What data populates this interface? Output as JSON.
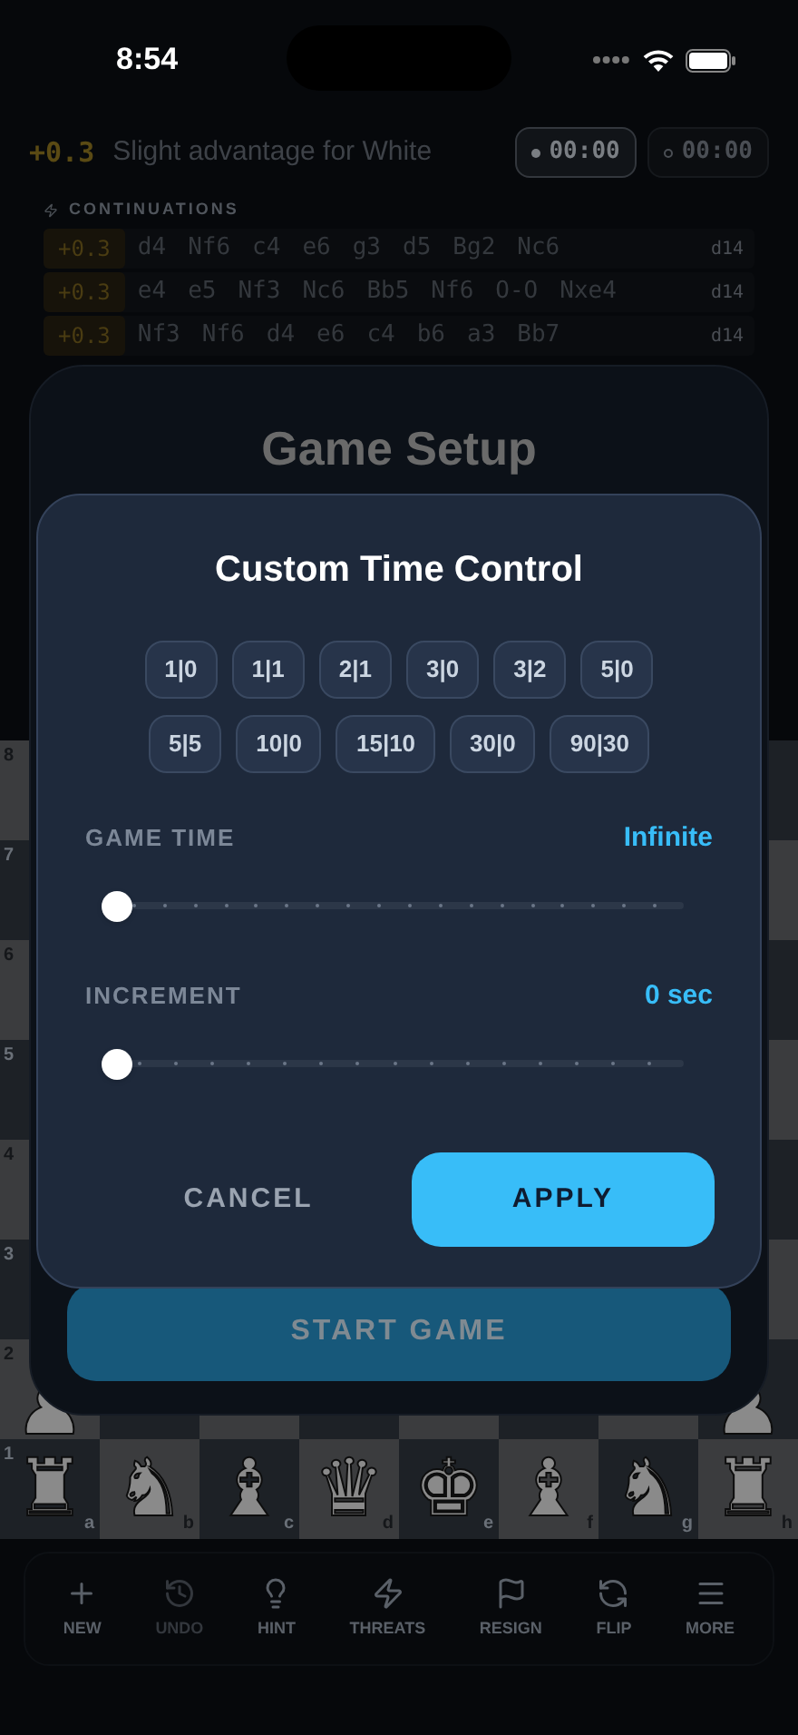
{
  "status_bar": {
    "time": "8:54"
  },
  "evaluation": {
    "score": "+0.3",
    "summary": "Slight advantage for White",
    "clocks": [
      {
        "time": "00:00",
        "active": true
      },
      {
        "time": "00:00",
        "active": false
      }
    ]
  },
  "continuations": {
    "title": "CONTINUATIONS",
    "lines": [
      {
        "score": "+0.3",
        "moves": [
          "d4",
          "Nf6",
          "c4",
          "e6",
          "g3",
          "d5",
          "Bg2",
          "Nc6"
        ],
        "depth": "d14"
      },
      {
        "score": "+0.3",
        "moves": [
          "e4",
          "e5",
          "Nf3",
          "Nc6",
          "Bb5",
          "Nf6",
          "O-O",
          "Nxe4"
        ],
        "depth": "d14"
      },
      {
        "score": "+0.3",
        "moves": [
          "Nf3",
          "Nf6",
          "d4",
          "e6",
          "c4",
          "b6",
          "a3",
          "Bb7"
        ],
        "depth": "d14"
      }
    ]
  },
  "board": {
    "files": [
      "a",
      "b",
      "c",
      "d",
      "e",
      "f",
      "g",
      "h"
    ],
    "rows": [
      {
        "rank": "8"
      },
      {
        "rank": "7"
      },
      {
        "rank": "6"
      },
      {
        "rank": "5"
      },
      {
        "rank": "4"
      },
      {
        "rank": "3"
      },
      {
        "rank": "2",
        "edge_pieces": [
          "♟",
          "♟"
        ]
      },
      {
        "rank": "1",
        "pieces": [
          "♜",
          "♞",
          "♝",
          "♛",
          "♚",
          "♝",
          "♞",
          "♜"
        ]
      }
    ]
  },
  "toolbar": [
    {
      "label": "NEW",
      "disabled": false
    },
    {
      "label": "UNDO",
      "disabled": true
    },
    {
      "label": "HINT",
      "disabled": false
    },
    {
      "label": "THREATS",
      "disabled": false
    },
    {
      "label": "RESIGN",
      "disabled": false
    },
    {
      "label": "FLIP",
      "disabled": false
    },
    {
      "label": "MORE",
      "disabled": false
    }
  ],
  "game_setup": {
    "title": "Game Setup",
    "start_button": "START GAME"
  },
  "dialog": {
    "title": "Custom Time Control",
    "preset_rows": [
      [
        "1|0",
        "1|1",
        "2|1",
        "3|0",
        "3|2",
        "5|0"
      ],
      [
        "5|5",
        "10|0",
        "15|10",
        "30|0",
        "90|30"
      ]
    ],
    "settings": [
      {
        "label": "GAME TIME",
        "value": "Infinite",
        "level": 0
      },
      {
        "label": "INCREMENT",
        "value": "0 sec",
        "level": 0
      }
    ],
    "cancel": "CANCEL",
    "apply": "APPLY"
  }
}
